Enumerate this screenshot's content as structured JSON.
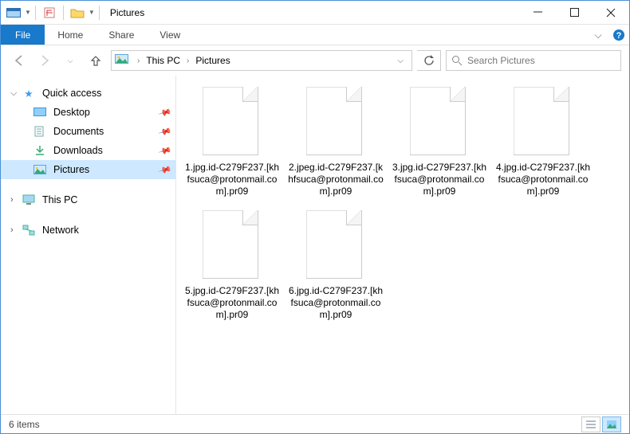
{
  "titlebar": {
    "title": "Pictures"
  },
  "ribbon": {
    "file": "File",
    "tabs": [
      "Home",
      "Share",
      "View"
    ]
  },
  "addressbar": {
    "crumbs": [
      "This PC",
      "Pictures"
    ]
  },
  "search": {
    "placeholder": "Search Pictures"
  },
  "sidebar": {
    "quick_access": {
      "label": "Quick access",
      "items": [
        {
          "label": "Desktop"
        },
        {
          "label": "Documents"
        },
        {
          "label": "Downloads"
        },
        {
          "label": "Pictures",
          "selected": true
        }
      ]
    },
    "this_pc": {
      "label": "This PC"
    },
    "network": {
      "label": "Network"
    }
  },
  "files": [
    {
      "name": "1.jpg.id-C279F237.[khfsuca@protonmail.com].pr09"
    },
    {
      "name": "2.jpeg.id-C279F237.[khfsuca@protonmail.com].pr09"
    },
    {
      "name": "3.jpg.id-C279F237.[khfsuca@protonmail.com].pr09"
    },
    {
      "name": "4.jpg.id-C279F237.[khfsuca@protonmail.com].pr09"
    },
    {
      "name": "5.jpg.id-C279F237.[khfsuca@protonmail.com].pr09"
    },
    {
      "name": "6.jpg.id-C279F237.[khfsuca@protonmail.com].pr09"
    }
  ],
  "statusbar": {
    "count": "6 items"
  }
}
